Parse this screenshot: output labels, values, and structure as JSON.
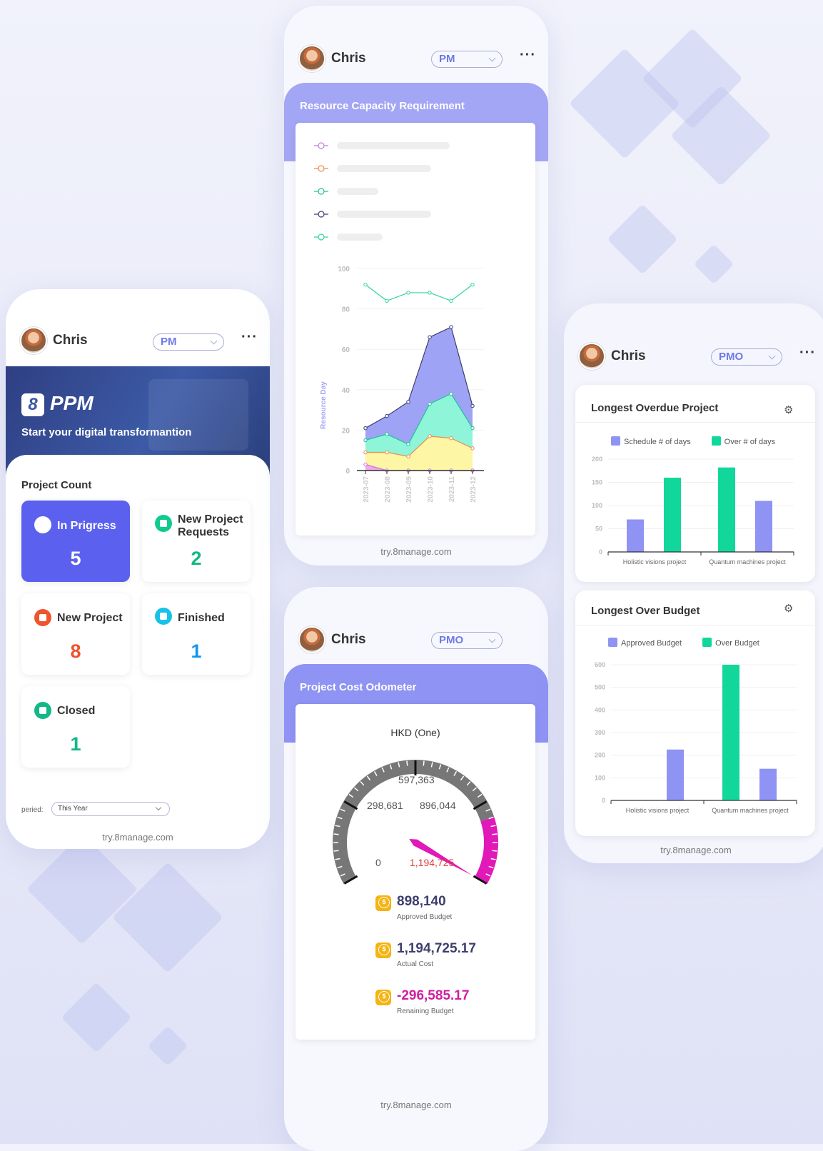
{
  "colors": {
    "accent": "#5b61ee",
    "purple_band": "#a3a5f5",
    "bar_purple": "#8e93f4",
    "bar_green": "#12d79a",
    "orange_text": "#f0542e",
    "green_text": "#12b886",
    "blue_text": "#1296f0",
    "magenta": "#e019b8",
    "coin": "#f4b412"
  },
  "left_phone": {
    "user": "Chris",
    "role": "PM",
    "more_icon": "more-dots-icon",
    "banner": {
      "logo_text": "PPM",
      "tagline": "Start your digital transformantion"
    },
    "section_title": "Project Count",
    "tiles": [
      {
        "label": "In Prigress",
        "value": "5",
        "icon": "pin-icon"
      },
      {
        "label": "New Project Requests",
        "value": "2",
        "icon": "star-badge-icon"
      },
      {
        "label": "New Project",
        "value": "8",
        "icon": "star-icon"
      },
      {
        "label": "Finished",
        "value": "1",
        "icon": "ok-icon"
      },
      {
        "label": "Closed",
        "value": "1",
        "icon": "square-icon"
      }
    ],
    "period_label": "peried:",
    "period_value": "This Year",
    "footer": "try.8manage.com"
  },
  "resource_phone": {
    "user": "Chris",
    "role": "PM",
    "title": "Resource Capacity Requirement",
    "footer": "try.8manage.com",
    "chart_data": {
      "type": "area",
      "categories": [
        "2023-07",
        "2023-08",
        "2023-09",
        "2023-10",
        "2023-11",
        "2023-12"
      ],
      "ylabel": "Resource Day",
      "ylim": [
        0,
        100
      ],
      "yticks": [
        "0",
        "20",
        "40",
        "60",
        "80",
        "100"
      ],
      "series": [
        {
          "color": "#c27bd6",
          "values": [
            3,
            0,
            0,
            0,
            0,
            0
          ]
        },
        {
          "color": "#ef8a52",
          "values": [
            9,
            9,
            7,
            17,
            16,
            11
          ]
        },
        {
          "color": "#1fc29a",
          "values": [
            15,
            18,
            13,
            33,
            38,
            21
          ]
        },
        {
          "color": "#3d3f6e",
          "values": [
            21,
            27,
            34,
            66,
            71,
            32
          ]
        },
        {
          "color": "#2dd4a6",
          "values": [
            92,
            84,
            88,
            88,
            84,
            92
          ]
        }
      ],
      "fills": [
        "#f3a6e8",
        "#fdf6a4",
        "#8ef5d8",
        "#9fa3f5"
      ],
      "grid": true
    }
  },
  "odometer_phone": {
    "user": "Chris",
    "role": "PMO",
    "title": "Project Cost Odometer",
    "footer": "try.8manage.com",
    "gauge": {
      "currency": "HKD (One)",
      "min_label": "0",
      "l1": "298,681",
      "l2": "597,363",
      "l3": "896,044",
      "max_label": "1,194,725",
      "value": 1194725.17,
      "max": 1194725
    },
    "stats": [
      {
        "value": "898,140",
        "label": "Approved Budget",
        "color": "#3d3f6e"
      },
      {
        "value": "1,194,725.17",
        "label": "Actual Cost",
        "color": "#3d3f6e"
      },
      {
        "value": "-296,585.17",
        "label": "Renaining Budget",
        "color": "#d11ea0"
      }
    ]
  },
  "right_phone": {
    "user": "Chris",
    "role": "PMO",
    "footer": "try.8manage.com",
    "charts": [
      {
        "title": "Longest Overdue Project",
        "chart_data": {
          "type": "bar",
          "categories": [
            "Holistic visions project",
            "Quantum machines project"
          ],
          "series": [
            {
              "name": "Schedule # of days",
              "values": [
                70,
                110
              ]
            },
            {
              "name": "Over # of days",
              "values": [
                160,
                182
              ]
            }
          ],
          "bars": [
            {
              "series": 0,
              "value": 70,
              "cat": 0
            },
            {
              "series": 1,
              "value": 160,
              "cat": 0
            },
            {
              "series": 1,
              "value": 182,
              "cat": 1
            },
            {
              "series": 0,
              "value": 110,
              "cat": 1
            }
          ],
          "ylim": [
            0,
            200
          ],
          "yticks": [
            "0",
            "50",
            "100",
            "150",
            "200"
          ],
          "legend": "top"
        }
      },
      {
        "title": "Longest Over Budget",
        "chart_data": {
          "type": "bar",
          "categories": [
            "Holistic visions project",
            "Quantum machines project"
          ],
          "series": [
            {
              "name": "Approved Budget",
              "values": [
                225,
                140
              ]
            },
            {
              "name": "Over Budget",
              "values": [
                0,
                600
              ]
            }
          ],
          "bars": [
            {
              "series": 0,
              "value": 225,
              "cat": 0
            },
            {
              "series": 1,
              "value": 600,
              "cat": 1
            },
            {
              "series": 0,
              "value": 140,
              "cat": 1
            }
          ],
          "ylim": [
            0,
            600
          ],
          "yticks": [
            "0",
            "100",
            "200",
            "300",
            "400",
            "500",
            "600"
          ],
          "legend": "top"
        }
      }
    ]
  }
}
